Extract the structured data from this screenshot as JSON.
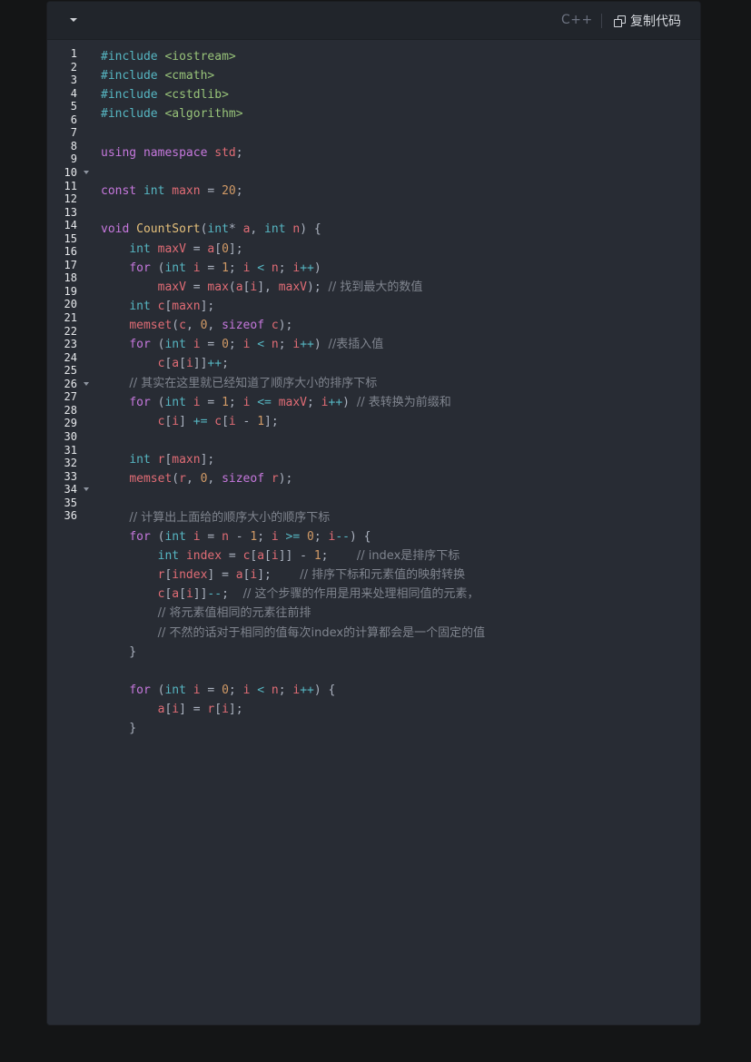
{
  "header": {
    "language": "C++",
    "copy_label": "复制代码",
    "icons": {
      "collapse": "caret-down-icon",
      "copy": "copy-icon"
    }
  },
  "gutter": {
    "line_numbers": [
      "1",
      "2",
      "3",
      "4",
      "5",
      "6",
      "7",
      "8",
      "9",
      "10",
      "11",
      "12",
      "13",
      "14",
      "15",
      "16",
      "17",
      "18",
      "19",
      "20",
      "21",
      "22",
      "23",
      "24",
      "25",
      "26",
      "27",
      "28",
      "29",
      "30",
      "31",
      "32",
      "33",
      "34",
      "35",
      "36"
    ],
    "fold_markers_at": [
      "10",
      "26",
      "34"
    ]
  },
  "code_lines": [
    [
      [
        "pp",
        "#include "
      ],
      [
        "str",
        "<iostream>"
      ]
    ],
    [
      [
        "pp",
        "#include "
      ],
      [
        "str",
        "<cmath>"
      ]
    ],
    [
      [
        "pp",
        "#include "
      ],
      [
        "str",
        "<cstdlib>"
      ]
    ],
    [
      [
        "pp",
        "#include "
      ],
      [
        "str",
        "<algorithm>"
      ]
    ],
    [],
    [
      [
        "kw",
        "using"
      ],
      [
        "p",
        " "
      ],
      [
        "kw",
        "namespace"
      ],
      [
        "p",
        " "
      ],
      [
        "var",
        "std"
      ],
      [
        "p",
        ";"
      ]
    ],
    [],
    [
      [
        "kw",
        "const"
      ],
      [
        "p",
        " "
      ],
      [
        "type",
        "int"
      ],
      [
        "p",
        " "
      ],
      [
        "var",
        "maxn"
      ],
      [
        "p",
        " = "
      ],
      [
        "num",
        "20"
      ],
      [
        "p",
        ";"
      ]
    ],
    [],
    [
      [
        "kw",
        "void"
      ],
      [
        "p",
        " "
      ],
      [
        "fn",
        "CountSort"
      ],
      [
        "p",
        "("
      ],
      [
        "type",
        "int"
      ],
      [
        "p",
        "* "
      ],
      [
        "var",
        "a"
      ],
      [
        "p",
        ", "
      ],
      [
        "type",
        "int"
      ],
      [
        "p",
        " "
      ],
      [
        "var",
        "n"
      ],
      [
        "p",
        ") {"
      ]
    ],
    [
      [
        "p",
        "    "
      ],
      [
        "type",
        "int"
      ],
      [
        "p",
        " "
      ],
      [
        "var",
        "maxV"
      ],
      [
        "p",
        " = "
      ],
      [
        "var",
        "a"
      ],
      [
        "p",
        "["
      ],
      [
        "num",
        "0"
      ],
      [
        "p",
        "];"
      ]
    ],
    [
      [
        "p",
        "    "
      ],
      [
        "kw",
        "for"
      ],
      [
        "p",
        " ("
      ],
      [
        "type",
        "int"
      ],
      [
        "p",
        " "
      ],
      [
        "var",
        "i"
      ],
      [
        "p",
        " = "
      ],
      [
        "num",
        "1"
      ],
      [
        "p",
        "; "
      ],
      [
        "var",
        "i"
      ],
      [
        "p",
        " "
      ],
      [
        "op",
        "<"
      ],
      [
        "p",
        " "
      ],
      [
        "var",
        "n"
      ],
      [
        "p",
        "; "
      ],
      [
        "var",
        "i"
      ],
      [
        "op",
        "++"
      ],
      [
        "p",
        ")"
      ]
    ],
    [
      [
        "p",
        "        "
      ],
      [
        "var",
        "maxV"
      ],
      [
        "p",
        " = "
      ],
      [
        "var",
        "max"
      ],
      [
        "p",
        "("
      ],
      [
        "var",
        "a"
      ],
      [
        "p",
        "["
      ],
      [
        "var",
        "i"
      ],
      [
        "p",
        "], "
      ],
      [
        "var",
        "maxV"
      ],
      [
        "p",
        "); "
      ],
      [
        "cm",
        "// 找到最大的数值"
      ]
    ],
    [
      [
        "p",
        "    "
      ],
      [
        "type",
        "int"
      ],
      [
        "p",
        " "
      ],
      [
        "var",
        "c"
      ],
      [
        "p",
        "["
      ],
      [
        "var",
        "maxn"
      ],
      [
        "p",
        "];"
      ]
    ],
    [
      [
        "p",
        "    "
      ],
      [
        "var",
        "memset"
      ],
      [
        "p",
        "("
      ],
      [
        "var",
        "c"
      ],
      [
        "p",
        ", "
      ],
      [
        "num",
        "0"
      ],
      [
        "p",
        ", "
      ],
      [
        "kw",
        "sizeof"
      ],
      [
        "p",
        " "
      ],
      [
        "var",
        "c"
      ],
      [
        "p",
        ");"
      ]
    ],
    [
      [
        "p",
        "    "
      ],
      [
        "kw",
        "for"
      ],
      [
        "p",
        " ("
      ],
      [
        "type",
        "int"
      ],
      [
        "p",
        " "
      ],
      [
        "var",
        "i"
      ],
      [
        "p",
        " = "
      ],
      [
        "num",
        "0"
      ],
      [
        "p",
        "; "
      ],
      [
        "var",
        "i"
      ],
      [
        "p",
        " "
      ],
      [
        "op",
        "<"
      ],
      [
        "p",
        " "
      ],
      [
        "var",
        "n"
      ],
      [
        "p",
        "; "
      ],
      [
        "var",
        "i"
      ],
      [
        "op",
        "++"
      ],
      [
        "p",
        ") "
      ],
      [
        "cm",
        "//表插入值"
      ]
    ],
    [
      [
        "p",
        "        "
      ],
      [
        "var",
        "c"
      ],
      [
        "p",
        "["
      ],
      [
        "var",
        "a"
      ],
      [
        "p",
        "["
      ],
      [
        "var",
        "i"
      ],
      [
        "p",
        "]]"
      ],
      [
        "op",
        "++"
      ],
      [
        "p",
        ";"
      ]
    ],
    [
      [
        "p",
        "    "
      ],
      [
        "cm",
        "// 其实在这里就已经知道了顺序大小的排序下标"
      ]
    ],
    [
      [
        "p",
        "    "
      ],
      [
        "kw",
        "for"
      ],
      [
        "p",
        " ("
      ],
      [
        "type",
        "int"
      ],
      [
        "p",
        " "
      ],
      [
        "var",
        "i"
      ],
      [
        "p",
        " = "
      ],
      [
        "num",
        "1"
      ],
      [
        "p",
        "; "
      ],
      [
        "var",
        "i"
      ],
      [
        "p",
        " "
      ],
      [
        "op",
        "<="
      ],
      [
        "p",
        " "
      ],
      [
        "var",
        "maxV"
      ],
      [
        "p",
        "; "
      ],
      [
        "var",
        "i"
      ],
      [
        "op",
        "++"
      ],
      [
        "p",
        ") "
      ],
      [
        "cm",
        "// 表转换为前缀和"
      ]
    ],
    [
      [
        "p",
        "        "
      ],
      [
        "var",
        "c"
      ],
      [
        "p",
        "["
      ],
      [
        "var",
        "i"
      ],
      [
        "p",
        "] "
      ],
      [
        "op",
        "+="
      ],
      [
        "p",
        " "
      ],
      [
        "var",
        "c"
      ],
      [
        "p",
        "["
      ],
      [
        "var",
        "i"
      ],
      [
        "p",
        " - "
      ],
      [
        "num",
        "1"
      ],
      [
        "p",
        "];"
      ]
    ],
    [],
    [
      [
        "p",
        "    "
      ],
      [
        "type",
        "int"
      ],
      [
        "p",
        " "
      ],
      [
        "var",
        "r"
      ],
      [
        "p",
        "["
      ],
      [
        "var",
        "maxn"
      ],
      [
        "p",
        "];"
      ]
    ],
    [
      [
        "p",
        "    "
      ],
      [
        "var",
        "memset"
      ],
      [
        "p",
        "("
      ],
      [
        "var",
        "r"
      ],
      [
        "p",
        ", "
      ],
      [
        "num",
        "0"
      ],
      [
        "p",
        ", "
      ],
      [
        "kw",
        "sizeof"
      ],
      [
        "p",
        " "
      ],
      [
        "var",
        "r"
      ],
      [
        "p",
        ");"
      ]
    ],
    [],
    [
      [
        "p",
        "    "
      ],
      [
        "cm",
        "// 计算出上面给的顺序大小的顺序下标"
      ]
    ],
    [
      [
        "p",
        "    "
      ],
      [
        "kw",
        "for"
      ],
      [
        "p",
        " ("
      ],
      [
        "type",
        "int"
      ],
      [
        "p",
        " "
      ],
      [
        "var",
        "i"
      ],
      [
        "p",
        " = "
      ],
      [
        "var",
        "n"
      ],
      [
        "p",
        " - "
      ],
      [
        "num",
        "1"
      ],
      [
        "p",
        "; "
      ],
      [
        "var",
        "i"
      ],
      [
        "p",
        " "
      ],
      [
        "op",
        ">="
      ],
      [
        "p",
        " "
      ],
      [
        "num",
        "0"
      ],
      [
        "p",
        "; "
      ],
      [
        "var",
        "i"
      ],
      [
        "op",
        "--"
      ],
      [
        "p",
        ") {"
      ]
    ],
    [
      [
        "p",
        "        "
      ],
      [
        "type",
        "int"
      ],
      [
        "p",
        " "
      ],
      [
        "var",
        "index"
      ],
      [
        "p",
        " = "
      ],
      [
        "var",
        "c"
      ],
      [
        "p",
        "["
      ],
      [
        "var",
        "a"
      ],
      [
        "p",
        "["
      ],
      [
        "var",
        "i"
      ],
      [
        "p",
        "]] - "
      ],
      [
        "num",
        "1"
      ],
      [
        "p",
        ";    "
      ],
      [
        "cm",
        "// index是排序下标"
      ]
    ],
    [
      [
        "p",
        "        "
      ],
      [
        "var",
        "r"
      ],
      [
        "p",
        "["
      ],
      [
        "var",
        "index"
      ],
      [
        "p",
        "] = "
      ],
      [
        "var",
        "a"
      ],
      [
        "p",
        "["
      ],
      [
        "var",
        "i"
      ],
      [
        "p",
        "];    "
      ],
      [
        "cm",
        "// 排序下标和元素值的映射转换"
      ]
    ],
    [
      [
        "p",
        "        "
      ],
      [
        "var",
        "c"
      ],
      [
        "p",
        "["
      ],
      [
        "var",
        "a"
      ],
      [
        "p",
        "["
      ],
      [
        "var",
        "i"
      ],
      [
        "p",
        "]]"
      ],
      [
        "op",
        "--"
      ],
      [
        "p",
        ";  "
      ],
      [
        "cm",
        "// 这个步骤的作用是用来处理相同值的元素，"
      ]
    ],
    [
      [
        "p",
        "        "
      ],
      [
        "cm",
        "// 将元素值相同的元素往前排"
      ]
    ],
    [
      [
        "p",
        "        "
      ],
      [
        "cm",
        "// 不然的话对于相同的值每次index的计算都会是一个固定的值"
      ]
    ],
    [
      [
        "p",
        "    }"
      ]
    ],
    [],
    [
      [
        "p",
        "    "
      ],
      [
        "kw",
        "for"
      ],
      [
        "p",
        " ("
      ],
      [
        "type",
        "int"
      ],
      [
        "p",
        " "
      ],
      [
        "var",
        "i"
      ],
      [
        "p",
        " = "
      ],
      [
        "num",
        "0"
      ],
      [
        "p",
        "; "
      ],
      [
        "var",
        "i"
      ],
      [
        "p",
        " "
      ],
      [
        "op",
        "<"
      ],
      [
        "p",
        " "
      ],
      [
        "var",
        "n"
      ],
      [
        "p",
        "; "
      ],
      [
        "var",
        "i"
      ],
      [
        "op",
        "++"
      ],
      [
        "p",
        ") {"
      ]
    ],
    [
      [
        "p",
        "        "
      ],
      [
        "var",
        "a"
      ],
      [
        "p",
        "["
      ],
      [
        "var",
        "i"
      ],
      [
        "p",
        "] = "
      ],
      [
        "var",
        "r"
      ],
      [
        "p",
        "["
      ],
      [
        "var",
        "i"
      ],
      [
        "p",
        "];"
      ]
    ],
    [
      [
        "p",
        "    }"
      ]
    ]
  ]
}
